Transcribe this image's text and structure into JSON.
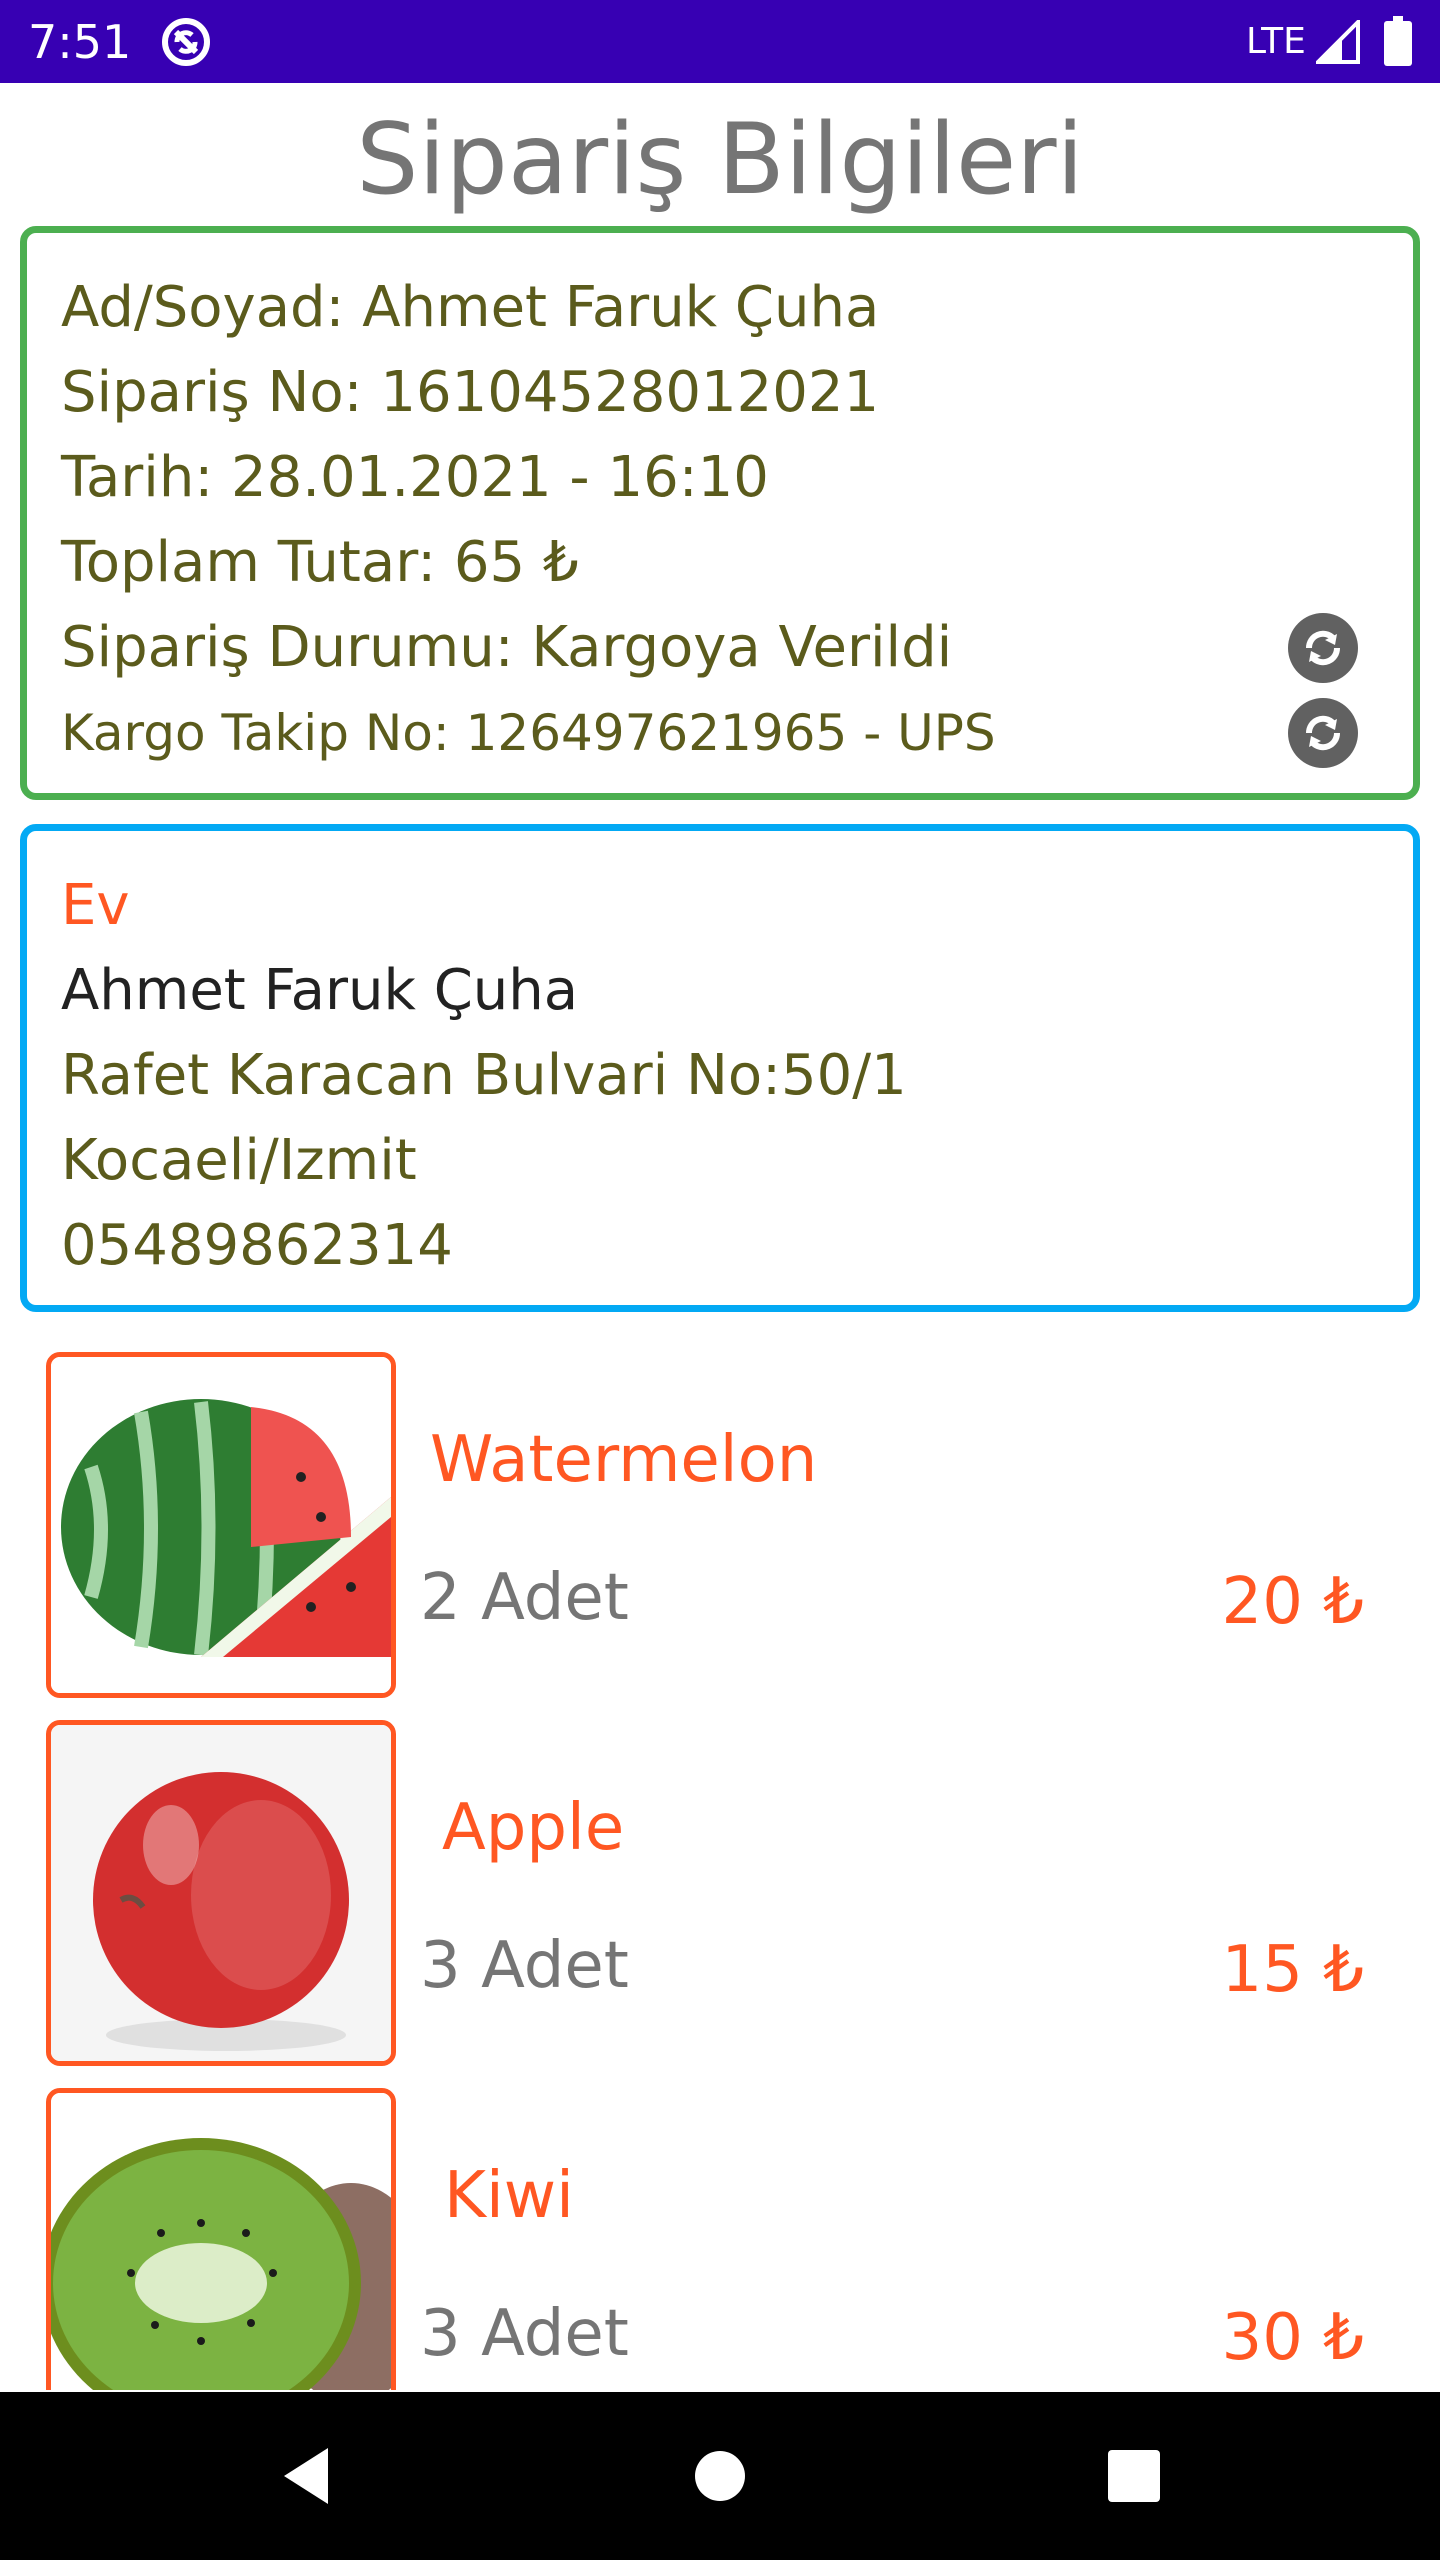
{
  "status_bar": {
    "time": "7:51",
    "network": "LTE",
    "app_icon": "sync-circle-icon",
    "signal_icon": "signal-icon",
    "battery_icon": "battery-icon"
  },
  "header": {
    "title": "Sipariş Bilgileri"
  },
  "order_info": {
    "customer": "Ad/Soyad: Ahmet Faruk Çuha",
    "order_no": "Sipariş No: 16104528012021",
    "date": "Tarih: 28.01.2021 - 16:10",
    "total": "Toplam Tutar: 65 ₺",
    "status": "Sipariş Durumu: Kargoya Verildi",
    "tracking": "Kargo Takip No: 126497621965 - UPS",
    "refresh_icon": "refresh-icon"
  },
  "address": {
    "label": "Ev",
    "name": "Ahmet Faruk Çuha",
    "street": "Rafet Karacan Bulvari No:50/1",
    "city": "Kocaeli/Izmit",
    "phone": "05489862314"
  },
  "products": [
    {
      "name": "Watermelon",
      "quantity": "2 Adet",
      "price": "20 ₺",
      "image": "watermelon-image"
    },
    {
      "name": "Apple",
      "quantity": "3 Adet",
      "price": "15 ₺",
      "image": "apple-image"
    },
    {
      "name": "Kiwi",
      "quantity": "3 Adet",
      "price": "30 ₺",
      "image": "kiwi-image"
    }
  ],
  "colors": {
    "status_bar": "#3700b3",
    "order_border": "#4caf50",
    "address_border": "#03a9f4",
    "accent": "#ff5722",
    "info_text": "#5b5b1c"
  },
  "nav_bar": {
    "back_icon": "back-icon",
    "home_icon": "home-icon",
    "recent_icon": "recent-apps-icon"
  }
}
